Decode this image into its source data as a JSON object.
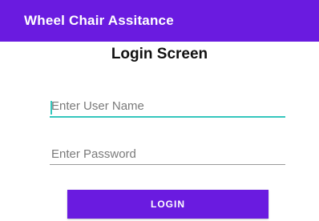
{
  "app_bar": {
    "title": "Wheel Chair Assitance",
    "background_color": "#6a1be0"
  },
  "screen": {
    "title": "Login Screen"
  },
  "form": {
    "username": {
      "value": "",
      "placeholder": "Enter User Name",
      "focused": true,
      "accent_color": "#35c7bd"
    },
    "password": {
      "value": "",
      "placeholder": "Enter Password"
    },
    "login_button": {
      "label": "LOGIN",
      "background_color": "#6a1be0"
    }
  }
}
